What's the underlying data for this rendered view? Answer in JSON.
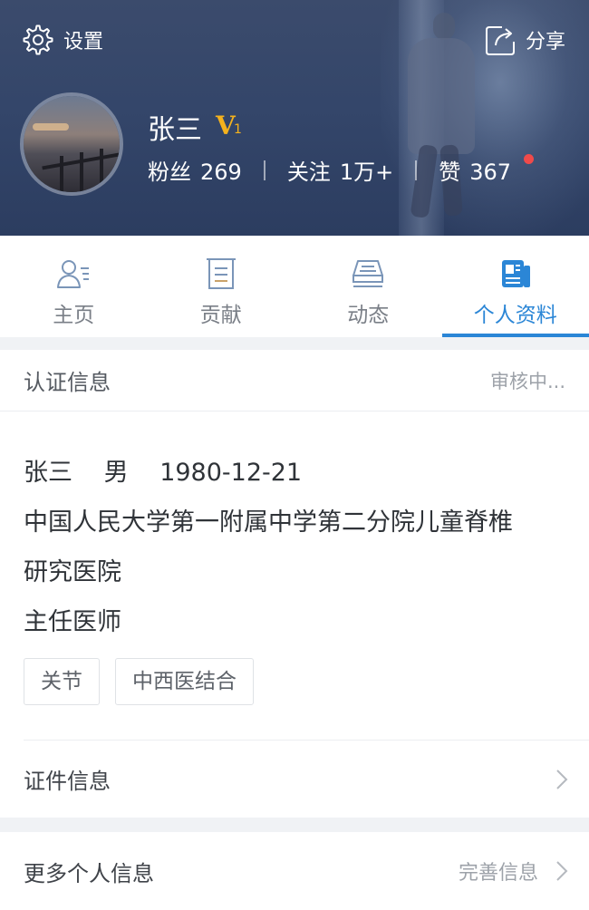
{
  "header": {
    "settings_label": "设置",
    "share_label": "分享",
    "user_name": "张三",
    "vip_badge": "V",
    "vip_level": "1",
    "stats": {
      "fans_label": "粉丝",
      "fans_value": "269",
      "follow_label": "关注",
      "follow_value": "1万+",
      "likes_label": "赞",
      "likes_value": "367"
    },
    "notification_dot_color": "#f04a4a"
  },
  "tabs": [
    {
      "label": "主页",
      "icon": "user-card-icon",
      "active": false
    },
    {
      "label": "贡献",
      "icon": "document-icon",
      "active": false
    },
    {
      "label": "动态",
      "icon": "stack-icon",
      "active": false
    },
    {
      "label": "个人资料",
      "icon": "profile-doc-icon",
      "active": true
    }
  ],
  "accent_color": "#2b86d6",
  "certification": {
    "title": "认证信息",
    "status": "审核中...",
    "name": "张三",
    "gender": "男",
    "birthdate": "1980-12-21",
    "institution_line1": "中国人民大学第一附属中学第二分院儿童脊椎",
    "institution_line2": "研究医院",
    "position": "主任医师",
    "tags": [
      "关节",
      "中西医结合"
    ],
    "certificate_label": "证件信息"
  },
  "more_info": {
    "label": "更多个人信息",
    "action": "完善信息"
  }
}
